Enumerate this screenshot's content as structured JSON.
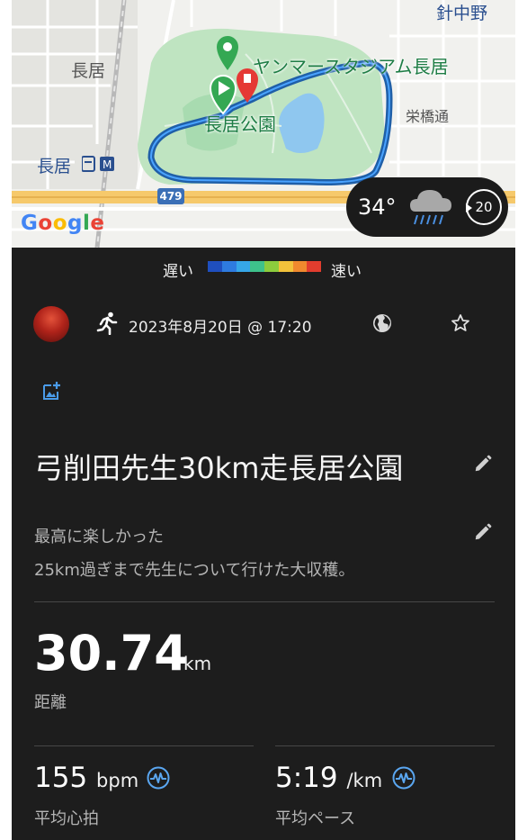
{
  "map": {
    "labels": {
      "top_right": "針中野",
      "nagai_area": "長居",
      "station": "長居",
      "sakaehashi": "栄橋通",
      "stadium": "ヤンマースタジアム長居",
      "park": "長居公園",
      "route_number": "479",
      "google": "Google"
    },
    "weather": {
      "temperature": "34°",
      "timer": "20",
      "icon": "rain-cloud-icon"
    },
    "colors": {
      "route": "#1f5fa8",
      "route_highlight": "#4aa3ff",
      "park": "#b9e3bd",
      "road": "#f6c96b"
    }
  },
  "speed_legend": {
    "slow_label": "遅い",
    "fast_label": "速い",
    "colors": [
      "#1f4fbf",
      "#2e7be0",
      "#36a7e8",
      "#3ec28b",
      "#8ccc3d",
      "#f2c23b",
      "#f0892e",
      "#e23d2e"
    ]
  },
  "activity": {
    "date": "2023年8月20日 @ 17:20",
    "title": "弓削田先生30km走長居公園",
    "description_line1": "最高に楽しかった",
    "description_line2": "25km過ぎまで先生について行けた大収穫。"
  },
  "stats": {
    "distance": {
      "value": "30.74",
      "unit": "km",
      "label": "距離"
    },
    "heart_rate": {
      "value": "155",
      "unit": "bpm",
      "label": "平均心拍"
    },
    "pace": {
      "value": "5:19",
      "unit": "/km",
      "label": "平均ペース"
    }
  }
}
